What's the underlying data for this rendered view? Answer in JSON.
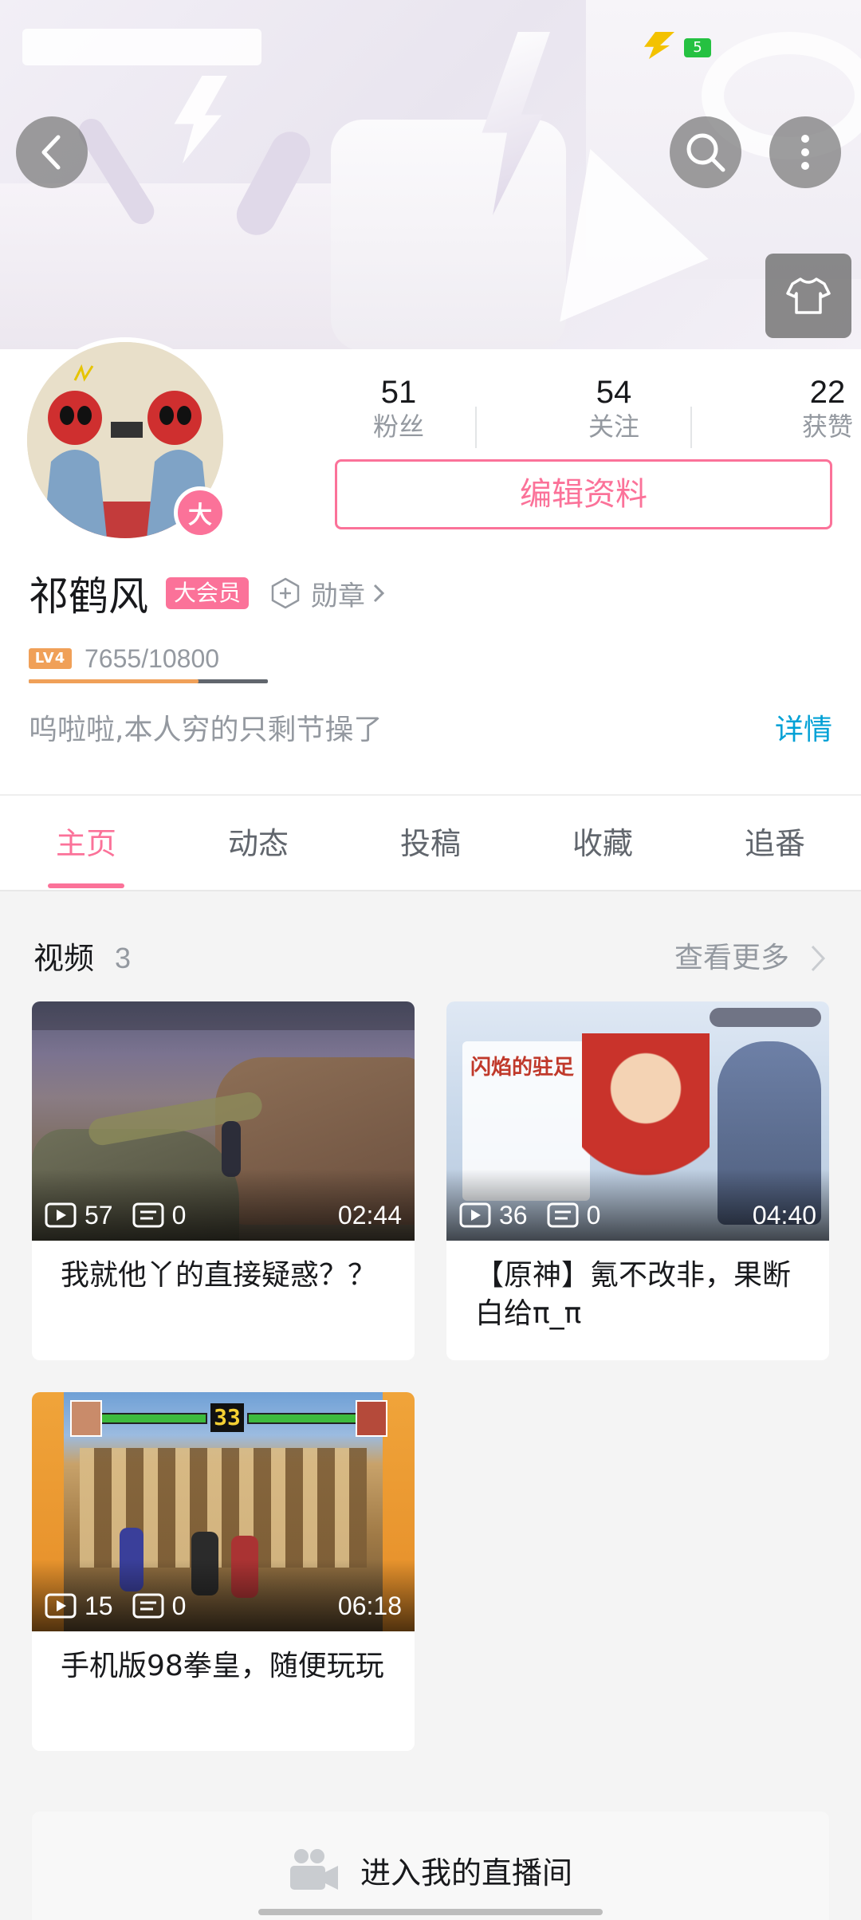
{
  "status_bar": {
    "battery_level": "5",
    "colors": {
      "battery": "#25c141",
      "charging": "#f3c200"
    }
  },
  "header": {
    "icons": {
      "back": "back-arrow-icon",
      "search": "search-icon",
      "more": "more-vertical-icon",
      "dress": "tshirt-icon"
    }
  },
  "profile": {
    "stats": [
      {
        "value": "51",
        "label": "粉丝"
      },
      {
        "value": "54",
        "label": "关注"
      },
      {
        "value": "22",
        "label": "获赞"
      }
    ],
    "edit_label": "编辑资料",
    "vip_avatar_badge": "大",
    "name": "祁鹤风",
    "vip_tag": "大会员",
    "medal_label": "勋章",
    "level_badge": "LV4",
    "exp_text": "7655/10800",
    "exp_fraction": 0.709,
    "signature": "呜啦啦,本人穷的只剩节操了",
    "detail_link": "详情"
  },
  "tabs": [
    {
      "label": "主页",
      "active": true
    },
    {
      "label": "动态"
    },
    {
      "label": "投稿"
    },
    {
      "label": "收藏"
    },
    {
      "label": "追番"
    }
  ],
  "videos_section": {
    "title": "视频",
    "count": "3",
    "see_more": "查看更多",
    "items": [
      {
        "plays": "57",
        "danmaku": "0",
        "duration": "02:44",
        "title": "我就他丫的直接疑惑？？"
      },
      {
        "plays": "36",
        "danmaku": "0",
        "duration": "04:40",
        "title": "【原神】氪不改非，果断白给π_π",
        "thumb_text": "闪焰的驻足"
      },
      {
        "plays": "15",
        "danmaku": "0",
        "duration": "06:18",
        "title": "手机版98拳皇，随便玩玩",
        "thumb_text": "33"
      }
    ]
  },
  "live_room": {
    "label": "进入我的直播间",
    "icon": "camera-icon"
  },
  "colors": {
    "accent": "#fb7299",
    "link": "#00a1d6",
    "level": "#f0a058"
  }
}
